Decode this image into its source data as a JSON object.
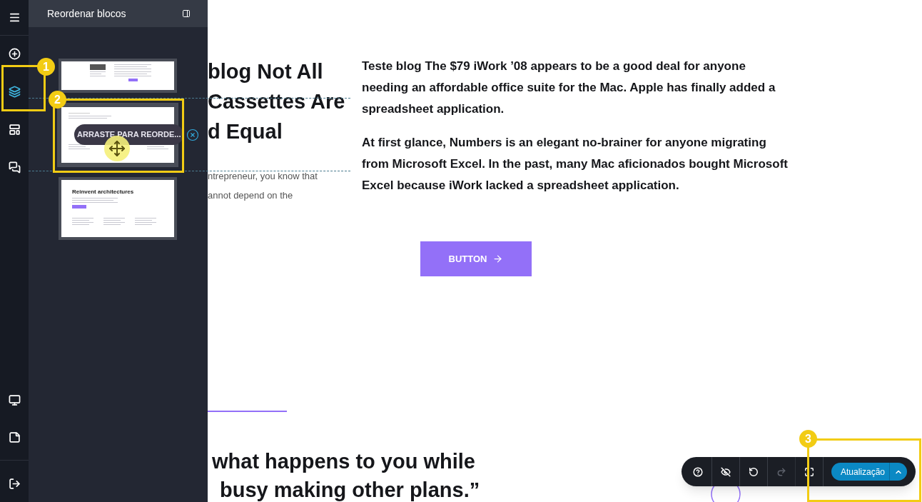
{
  "rail_items": [
    {
      "kind": "menu",
      "selected": false
    },
    {
      "kind": "add",
      "selected": false
    },
    {
      "kind": "layers",
      "selected": true
    },
    {
      "kind": "blocks",
      "selected": false
    },
    {
      "kind": "comments",
      "selected": false
    },
    {
      "kind": "monitor",
      "selected": false
    },
    {
      "kind": "note",
      "selected": false
    },
    {
      "kind": "exit",
      "selected": false
    }
  ],
  "panel": {
    "title": "Reordenar blocos",
    "blocks": [
      {
        "kind": "hero",
        "selected": false
      },
      {
        "kind": "quote",
        "selected": true,
        "drag_label": "ARRASTE PARA REORDE..."
      },
      {
        "kind": "features",
        "selected": false,
        "heading": "Reinvent architectures"
      }
    ]
  },
  "page": {
    "title_lines": [
      "blog Not All",
      "Cassettes Are",
      "d Equal"
    ],
    "intro_lines": [
      "ntrepreneur, you know that",
      "annot depend on the"
    ],
    "paragraphs": [
      "Teste blog The $79 iWork ’08 appears to be a good deal for anyone needing an affordable office suite for the Mac. Apple has finally added a spreadsheet application.",
      "At first glance, Numbers is an elegant no-brainer for anyone migrating from Microsoft Excel. In the past, many Mac aficionados bought Microsoft Excel because iWork lacked a spreadsheet application."
    ],
    "button": "BUTTON",
    "quote_lines": [
      "what happens to you while",
      "busy making other plans.”"
    ]
  },
  "toolbar": {
    "buttons": [
      {
        "kind": "help",
        "disabled": false
      },
      {
        "kind": "hide",
        "disabled": false
      },
      {
        "kind": "undo",
        "disabled": false
      },
      {
        "kind": "redo",
        "disabled": true
      },
      {
        "kind": "fullscreen",
        "disabled": false
      }
    ],
    "update_button": "Atualização"
  },
  "annotations": [
    {
      "label": "1"
    },
    {
      "label": "2"
    },
    {
      "label": "3"
    }
  ]
}
